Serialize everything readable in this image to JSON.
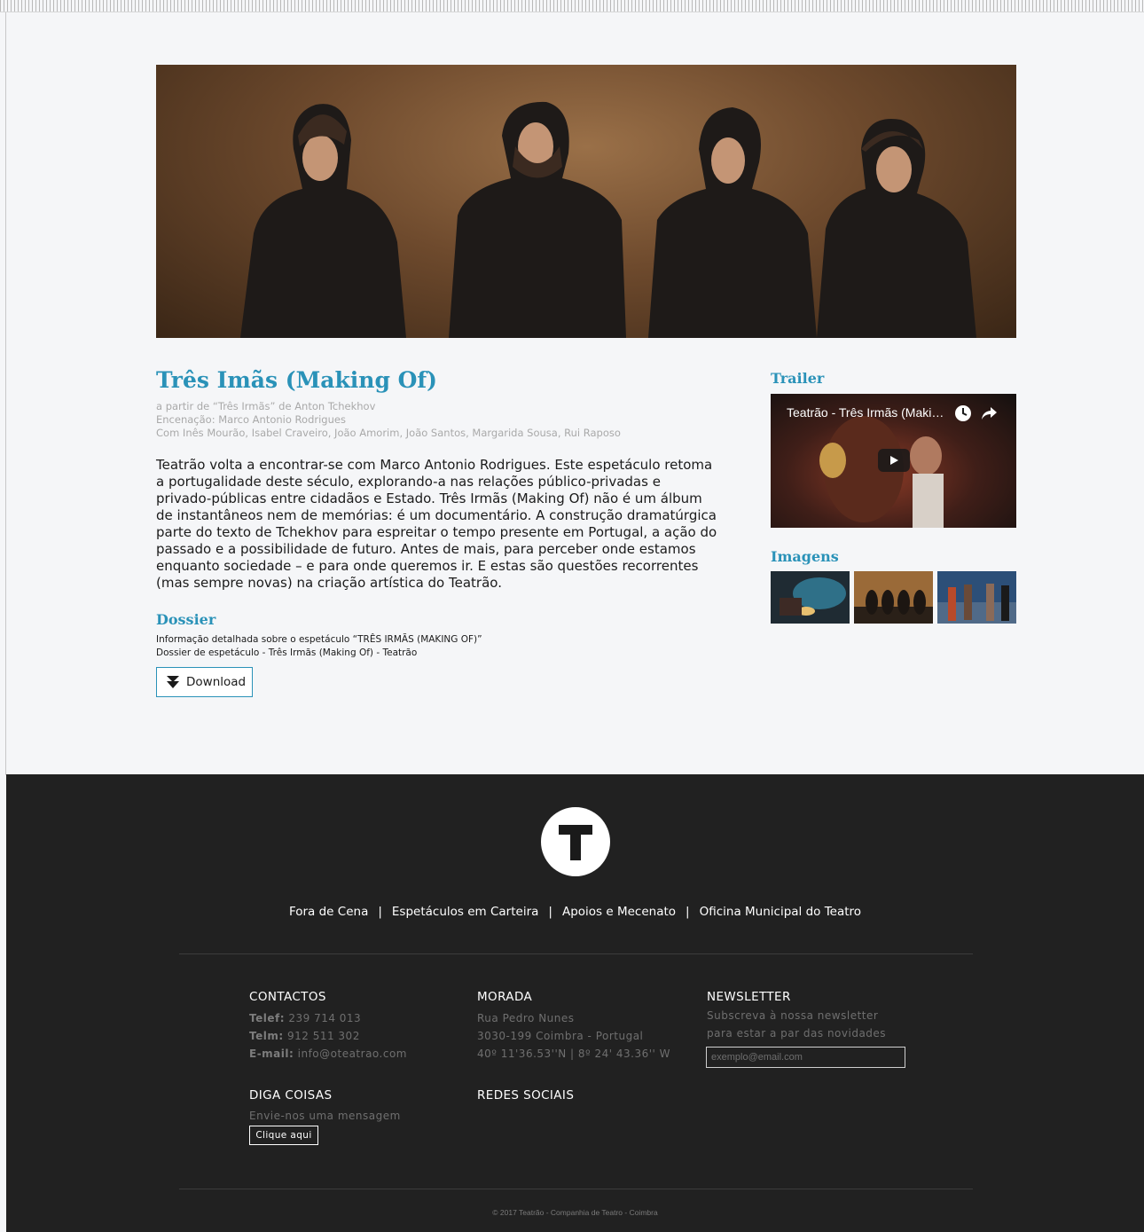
{
  "show": {
    "title": "Três Imãs (Making Of)",
    "credits": [
      "a partir de “Três Irmãs” de Anton Tchekhov",
      "Encenação: Marco Antonio Rodrigues",
      "Com Inês Mourão, Isabel Craveiro, João Amorim,  João Santos, Margarida Sousa, Rui Raposo"
    ],
    "description": "Teatrão volta a encontrar-se com Marco Antonio Rodrigues. Este espetáculo retoma a portugalidade deste século, explorando-a nas relações público-privadas e privado-públicas entre cidadãos e Estado. Três Irmãs (Making Of) não é um álbum de instantâneos nem de memórias: é um documentário. A construção dramatúrgica parte do texto de Tchekhov para espreitar o tempo presente em Portugal, a ação do passado e a possibilidade de futuro. Antes de mais, para perceber onde estamos enquanto sociedade – e para onde queremos ir. E estas são questões recorrentes (mas sempre novas) na criação artística do Teatrão."
  },
  "dossier": {
    "heading": "Dossier",
    "lines": [
      "Informação detalhada sobre o espetáculo “TRÊS IRMÃS (MAKING OF)”",
      "Dossier de espetáculo - Três Irmãs (Making Of) - Teatrão"
    ],
    "download_label": "Download"
  },
  "sidebar": {
    "trailer_heading": "Trailer",
    "trailer_video_title": "Teatrão - Três Irmãs (Making Of)",
    "images_heading": "Imagens",
    "images_count": 3
  },
  "footer": {
    "logo_letter": "T",
    "nav": [
      "Fora de Cena",
      "Espetáculos em Carteira",
      "Apoios e Mecenato",
      "Oficina Municipal do Teatro"
    ],
    "nav_separator": "|",
    "contactos": {
      "heading": "CONTACTOS",
      "telef_label": "Telef:",
      "telef": "239 714 013",
      "telm_label": "Telm:",
      "telm": "912 511 302",
      "email_label": "E-mail:",
      "email": "info@oteatrao.com"
    },
    "morada": {
      "heading": "MORADA",
      "lines": [
        "Rua Pedro Nunes",
        "3030-199 Coimbra - Portugal",
        "40º 11'36.53''N | 8º 24' 43.36'' W"
      ]
    },
    "newsletter": {
      "heading": "NEWSLETTER",
      "lines": [
        "Subscreva à nossa newsletter",
        "para estar a par das novidades"
      ],
      "placeholder": "exemplo@email.com"
    },
    "diga_coisas": {
      "heading": "DIGA COISAS",
      "text": "Envie-nos uma mensagem",
      "button": "Clique aqui"
    },
    "redes_sociais": {
      "heading": "REDES SOCIAIS"
    },
    "copyright": "© 2017 Teatrão - Companhia de Teatro - Coimbra"
  },
  "colors": {
    "accent": "#2a92b8",
    "page_bg": "#f5f6f8",
    "footer_bg": "#212121"
  }
}
